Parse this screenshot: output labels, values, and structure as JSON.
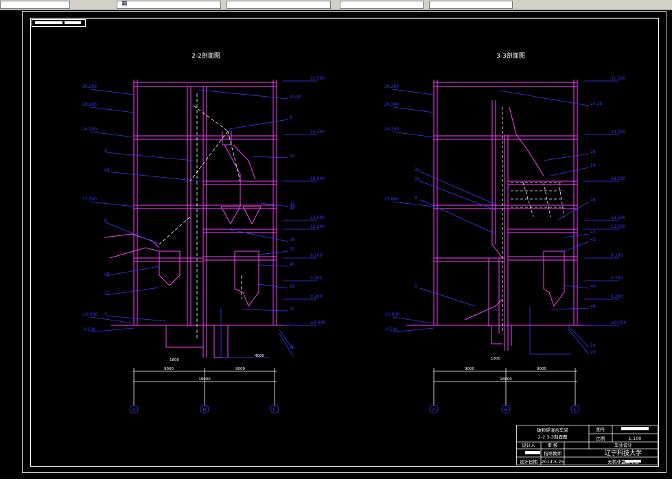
{
  "window": {
    "title_glyph": "▦"
  },
  "left_view": {
    "title": "2-2剖面图",
    "elev_left": [
      "30.200",
      "28.200",
      "24.200",
      "17.500",
      "±0.000",
      "-0.500"
    ],
    "elev_right": [
      "31.500",
      "24.200",
      "18.900",
      "13.500",
      "12.200",
      "9.200",
      "3.700",
      "0.200",
      "±0.000"
    ],
    "leaders_left": [
      "2",
      "24",
      "6",
      "25",
      "21",
      "4"
    ],
    "leaders_right": [
      "24.20",
      "8",
      "10",
      "35",
      "48",
      "36",
      "33",
      "40",
      "18",
      "10",
      "20"
    ],
    "dims": [
      "9000",
      "18000",
      "9000",
      "1800",
      "4000"
    ],
    "axes": [
      "A",
      "B",
      "C"
    ]
  },
  "right_view": {
    "title": "3-3剖面图",
    "elev_left": [
      "30.200",
      "28.200",
      "24.200",
      "15.800",
      "±0.000",
      "-0.500"
    ],
    "elev_right": [
      "31.500",
      "24.200",
      "18.200",
      "13.500",
      "12.200",
      "9.200",
      "3.700",
      "0.200",
      "±0.000"
    ],
    "leaders_left": [
      "22",
      "16",
      "8",
      "5"
    ],
    "leaders_right": [
      "24.20",
      "28",
      "19",
      "18",
      "43",
      "42",
      "40",
      "44",
      "14",
      "20"
    ],
    "dims": [
      "9000",
      "18000",
      "9000",
      "1800"
    ],
    "axes": [
      "A",
      "B",
      "C"
    ]
  },
  "title_block": {
    "project": "破粉碎混合车间",
    "drawing": "2-2  3-3剖面图",
    "label_no": "图号",
    "label_scale": "比例",
    "scale": "1:100",
    "label_designer": "设计人",
    "label_reviewer": "审 核",
    "label_stage": "毕业设计",
    "label_date": "设计日期",
    "label_instructor": "指导教师",
    "date": "2014.5.25",
    "school": "辽宁科技大学",
    "major": "无机非金属专业"
  },
  "colors": {
    "bg": "#000000",
    "wall": "#ff40ff",
    "blue": "#3c3cff",
    "white": "#ffffff",
    "gray": "#c8c8c8"
  }
}
